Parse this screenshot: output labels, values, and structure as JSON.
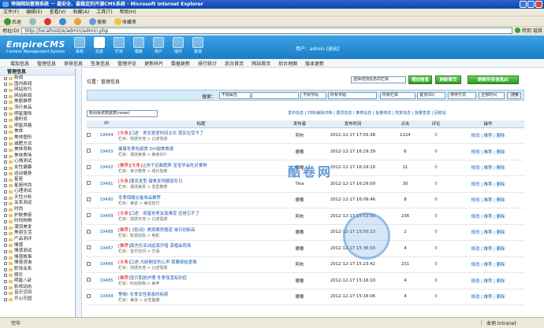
{
  "window": {
    "title": "帝国网站管理系统 － 最安全、最稳定的开源CMS系统 - Microsoft Internet Explorer"
  },
  "menu": [
    "文件(F)",
    "编辑(E)",
    "查看(V)",
    "收藏(A)",
    "工具(T)",
    "帮助(H)"
  ],
  "toolbar": {
    "back": "后退",
    "search": "搜索",
    "favorites": "收藏夹"
  },
  "address": {
    "label": "地址(D)",
    "url": "http://localhost/e/admin/admin.php",
    "go": "转到",
    "links": "链接"
  },
  "logo": {
    "name": "EmpireCMS",
    "sub": "Content Management System"
  },
  "nav": [
    "系统",
    "信息",
    "栏目",
    "模板",
    "用户",
    "插件",
    "其他"
  ],
  "user": {
    "text": "用户：admin [退出]"
  },
  "subnav": [
    "增加信息",
    "管理信息",
    "审核信息",
    "签发信息",
    "管理评论",
    "更新碎片",
    "数据更新",
    "排行统计",
    "后台首页",
    "网站首页",
    "后台地图",
    "版本更新"
  ],
  "sidebar": {
    "title": "管理信息",
    "items": [
      "新闻",
      "国内新闻",
      "网站技巧",
      "网站新闻",
      "美剧推荐",
      "流行单品",
      "明星服饰",
      "潮时尚",
      "明星风格",
      "美体",
      "美体塑形",
      "减肥方法",
      "美体导购",
      "美体秀场",
      "心情测试",
      "女性健康",
      "运动健身",
      "星座",
      "星座时尚",
      "心理测试",
      "天性分析",
      "关系测试",
      "时尚",
      "护肤美容",
      "时尚购物",
      "潮流美发",
      "美丽生活",
      "产品测评",
      "情感",
      "情感测试",
      "情感故事",
      "情感咨询",
      "职场关系",
      "娱乐",
      "明星八卦",
      "影视动态",
      "音乐空间",
      "开心乐园"
    ]
  },
  "main": {
    "position": "位置：管理信息",
    "column_select": "选择增加信息的栏目",
    "btn_add": "增加信息",
    "btn_refresh": "刷新首页",
    "btn_refresh_all": "刷新所有信息JS",
    "search_label": "搜索：",
    "search_selects": [
      "不限属性",
      "不限字段",
      "所有专题",
      "所有栏目",
      "置顶(ID)",
      "排序方式",
      "全部时间"
    ],
    "search_btn": "搜索",
    "model_select": "新闻系统数据表(news)",
    "links": "发布信息 | 归档/解除归档 | 置顶信息 | 推荐信息 | 批量修改 | 恢复信息 | 批量签发 | 回收站"
  },
  "table": {
    "headers": [
      "ID",
      "标题",
      "发布者",
      "发布时间",
      "点击",
      "评论",
      "操作"
    ],
    "rows": [
      {
        "id": "19494",
        "tag": "[头条]",
        "title": "口述：男女爱爱时间太长 我实在受不了",
        "col": "栏目：情感天地 > 口述情感",
        "author": "阿布",
        "time": "2012-12-17 17:03:38",
        "hits": "1124",
        "comments": "0",
        "ops": "修改 | 推荐 | 删除"
      },
      {
        "id": "19493",
        "tag": "",
        "title": "健康冬季吃甜食 DIY甜美食谱",
        "col": "栏目：潮流美食 > 美食DIY",
        "author": "嘟嘟",
        "time": "2012-12-17 16:29:39",
        "hits": "6",
        "comments": "0",
        "ops": "修改 | 推荐 | 删除"
      },
      {
        "id": "19492",
        "tag": "[推荐][头条]",
        "title": "让孩子远离肥胖 宝宝学会吃对食物",
        "col": "栏目：亲子教育 > 成长指南",
        "author": "嘟嘟",
        "time": "2012-12-17 16:24:10",
        "hits": "21",
        "comments": "0",
        "ops": "修改 | 推荐 | 删除"
      },
      {
        "id": "19491",
        "tag": "[头条]",
        "title": "潮流发型 甜美发饰靓丽冬日",
        "col": "栏目：潮流美发 > 发型推荐",
        "author": "Tina",
        "time": "2012-12-17 16:29:09",
        "hits": "30",
        "comments": "0",
        "ops": "修改 | 推荐 | 删除"
      },
      {
        "id": "19490",
        "tag": "",
        "title": "冬季保暖必备单品推荐",
        "col": "栏目：美容 > 美妆技巧",
        "author": "嘟嘟",
        "time": "2012-12-17 16:09:46",
        "hits": "8",
        "comments": "0",
        "ops": "修改 | 推荐 | 删除"
      },
      {
        "id": "19489",
        "tag": "[头条]",
        "title": "口述：闺蜜抢男友真难受 还是忘不了",
        "col": "栏目：情感天地 > 口述情感",
        "author": "阿布",
        "time": "2012-12-17 15:53:50",
        "hits": "236",
        "comments": "0",
        "ops": "修改 | 推荐 | 删除"
      },
      {
        "id": "19488",
        "tag": "[推荐]",
        "title": "《影动》首周票房报道 单日创新高",
        "col": "栏目：影视动态 > 电影",
        "author": "嘟嘟",
        "time": "2012-12-17 15:50:13",
        "hits": "2",
        "comments": "0",
        "ops": "修改 | 推荐 | 删除"
      },
      {
        "id": "19487",
        "tag": "[推荐]",
        "title": "周杰伦亚洲巡演开唱 演唱会现场",
        "col": "栏目：音乐空间 > 华语",
        "author": "嘟嘟",
        "time": "2012-12-17 15:36:59",
        "hits": "4",
        "comments": "0",
        "ops": "修改 | 推荐 | 删除"
      },
      {
        "id": "19486",
        "tag": "[头条]",
        "title": "口述-大龄剩女的心声 我要嫁给爱情",
        "col": "栏目：情感天地 > 口述情感",
        "author": "阿布",
        "time": "2012-12-17 15:23:42",
        "hits": "231",
        "comments": "0",
        "ops": "修改 | 推荐 | 删除"
      },
      {
        "id": "19485",
        "tag": "[推荐]",
        "title": "宝贝肌肤护理 冬季保湿有妙招",
        "col": "栏目：时尚购物 > 美甲",
        "author": "嘟嘟",
        "time": "2012-12-17 15:16:10",
        "hits": "4",
        "comments": "0",
        "ops": "修改 | 推荐 | 删除"
      },
      {
        "id": "19484",
        "tag": "",
        "title": "警惕! 冬季女性易患的疾病",
        "col": "栏目：美体 > 女性健康",
        "author": "嘟嘟",
        "time": "2012-12-17 15:16:06",
        "hits": "4",
        "comments": "0",
        "ops": "修改 | 推荐 | 删除"
      }
    ]
  },
  "watermark": "酷卷网",
  "status": {
    "done": "完毕",
    "zone": "本地 Intranet"
  }
}
